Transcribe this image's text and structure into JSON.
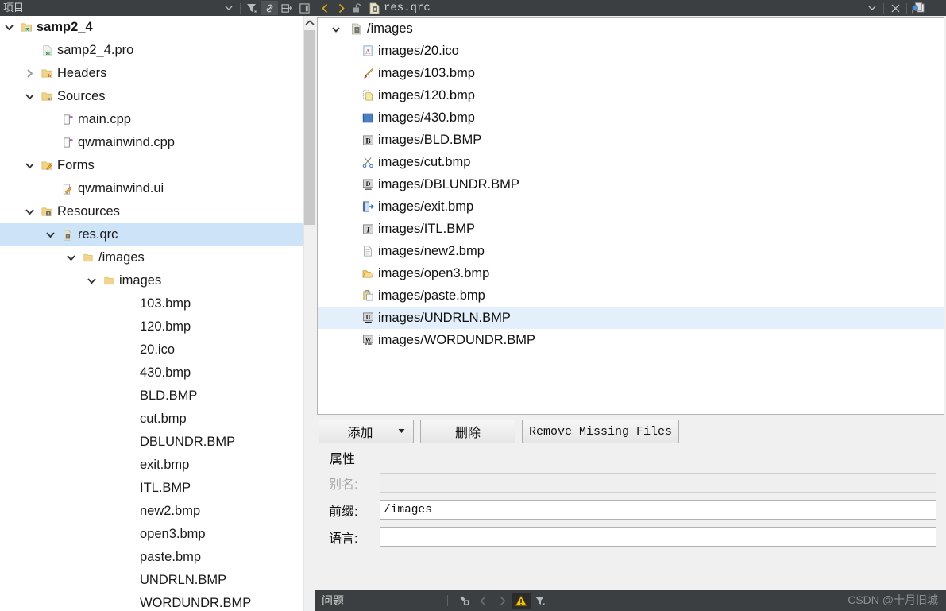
{
  "left_panel": {
    "title": "项目",
    "toolbar": [
      {
        "name": "dropdown-arrow-icon",
        "glyph": "▾"
      },
      {
        "name": "filter-icon",
        "glyph": "filter"
      },
      {
        "name": "link-icon",
        "glyph": "link"
      },
      {
        "name": "split-add-icon",
        "glyph": "split"
      },
      {
        "name": "collapse-panel-icon",
        "glyph": "panel"
      }
    ],
    "tree": [
      {
        "label": "samp2_4",
        "indent": 0,
        "twisty": "expanded",
        "icon": "qt-project-folder-icon",
        "bold": true,
        "selected": false
      },
      {
        "label": "samp2_4.pro",
        "indent": 1,
        "twisty": "none",
        "icon": "qt-pro-file-icon",
        "bold": false,
        "selected": false
      },
      {
        "label": "Headers",
        "indent": 1,
        "twisty": "collapsed",
        "icon": "headers-folder-icon",
        "bold": false,
        "selected": false
      },
      {
        "label": "Sources",
        "indent": 1,
        "twisty": "expanded",
        "icon": "sources-folder-icon",
        "bold": false,
        "selected": false
      },
      {
        "label": "main.cpp",
        "indent": 2,
        "twisty": "none",
        "icon": "cpp-file-icon",
        "bold": false,
        "selected": false
      },
      {
        "label": "qwmainwind.cpp",
        "indent": 2,
        "twisty": "none",
        "icon": "cpp-file-icon",
        "bold": false,
        "selected": false
      },
      {
        "label": "Forms",
        "indent": 1,
        "twisty": "expanded",
        "icon": "forms-folder-icon",
        "bold": false,
        "selected": false
      },
      {
        "label": "qwmainwind.ui",
        "indent": 2,
        "twisty": "none",
        "icon": "ui-file-icon",
        "bold": false,
        "selected": false
      },
      {
        "label": "Resources",
        "indent": 1,
        "twisty": "expanded",
        "icon": "resources-folder-icon",
        "bold": false,
        "selected": false
      },
      {
        "label": "res.qrc",
        "indent": 2,
        "twisty": "expanded",
        "icon": "qrc-file-icon",
        "bold": false,
        "selected": true
      },
      {
        "label": "/images",
        "indent": 3,
        "twisty": "expanded",
        "icon": "folder-icon",
        "bold": false,
        "selected": false
      },
      {
        "label": "images",
        "indent": 4,
        "twisty": "expanded",
        "icon": "folder-icon",
        "bold": false,
        "selected": false
      },
      {
        "label": "103.bmp",
        "indent": 5,
        "twisty": "none",
        "icon": "none",
        "bold": false,
        "selected": false
      },
      {
        "label": "120.bmp",
        "indent": 5,
        "twisty": "none",
        "icon": "none",
        "bold": false,
        "selected": false
      },
      {
        "label": "20.ico",
        "indent": 5,
        "twisty": "none",
        "icon": "none",
        "bold": false,
        "selected": false
      },
      {
        "label": "430.bmp",
        "indent": 5,
        "twisty": "none",
        "icon": "none",
        "bold": false,
        "selected": false
      },
      {
        "label": "BLD.BMP",
        "indent": 5,
        "twisty": "none",
        "icon": "none",
        "bold": false,
        "selected": false
      },
      {
        "label": "cut.bmp",
        "indent": 5,
        "twisty": "none",
        "icon": "none",
        "bold": false,
        "selected": false
      },
      {
        "label": "DBLUNDR.BMP",
        "indent": 5,
        "twisty": "none",
        "icon": "none",
        "bold": false,
        "selected": false
      },
      {
        "label": "exit.bmp",
        "indent": 5,
        "twisty": "none",
        "icon": "none",
        "bold": false,
        "selected": false
      },
      {
        "label": "ITL.BMP",
        "indent": 5,
        "twisty": "none",
        "icon": "none",
        "bold": false,
        "selected": false
      },
      {
        "label": "new2.bmp",
        "indent": 5,
        "twisty": "none",
        "icon": "none",
        "bold": false,
        "selected": false
      },
      {
        "label": "open3.bmp",
        "indent": 5,
        "twisty": "none",
        "icon": "none",
        "bold": false,
        "selected": false
      },
      {
        "label": "paste.bmp",
        "indent": 5,
        "twisty": "none",
        "icon": "none",
        "bold": false,
        "selected": false
      },
      {
        "label": "UNDRLN.BMP",
        "indent": 5,
        "twisty": "none",
        "icon": "none",
        "bold": false,
        "selected": false
      },
      {
        "label": "WORDUNDR.BMP",
        "indent": 5,
        "twisty": "none",
        "icon": "none",
        "bold": false,
        "selected": false
      }
    ]
  },
  "editor": {
    "tab_title": "res.qrc",
    "nav_back_icon": "chevron-left-icon",
    "nav_forward_icon": "chevron-right-icon",
    "lock_icon": "unlocked-icon",
    "file_icon": "qrc-file-icon",
    "dropdown_icon": "chevron-down-icon",
    "close_icon": "close-icon",
    "split_icon": "split-editor-icon"
  },
  "qrc_editor": {
    "prefix_header": {
      "label": "/images",
      "icon": "qrc-prefix-icon"
    },
    "files": [
      {
        "label": "images/20.ico",
        "icon": "ico-image-icon",
        "selected": false
      },
      {
        "label": "images/103.bmp",
        "icon": "pencil-icon",
        "selected": false
      },
      {
        "label": "images/120.bmp",
        "icon": "copy-icon",
        "selected": false
      },
      {
        "label": "images/430.bmp",
        "icon": "blue-square-icon",
        "selected": false
      },
      {
        "label": "images/BLD.BMP",
        "icon": "bold-icon",
        "selected": false
      },
      {
        "label": "images/cut.bmp",
        "icon": "scissors-icon",
        "selected": false
      },
      {
        "label": "images/DBLUNDR.BMP",
        "icon": "double-underline-icon",
        "selected": false
      },
      {
        "label": "images/exit.bmp",
        "icon": "exit-door-icon",
        "selected": false
      },
      {
        "label": "images/ITL.BMP",
        "icon": "italic-icon",
        "selected": false
      },
      {
        "label": "images/new2.bmp",
        "icon": "new-document-icon",
        "selected": false
      },
      {
        "label": "images/open3.bmp",
        "icon": "open-folder-icon",
        "selected": false
      },
      {
        "label": "images/paste.bmp",
        "icon": "paste-icon",
        "selected": false
      },
      {
        "label": "images/UNDRLN.BMP",
        "icon": "underline-icon",
        "selected": true
      },
      {
        "label": "images/WORDUNDR.BMP",
        "icon": "word-underline-icon",
        "selected": false
      }
    ],
    "buttons": {
      "add": "添加",
      "add_caret": "▼",
      "remove": "删除",
      "remove_missing": "Remove Missing Files"
    },
    "properties": {
      "legend": "属性",
      "alias": {
        "label": "别名:",
        "value": "",
        "disabled": true
      },
      "prefix": {
        "label": "前缀:",
        "value": "/images",
        "disabled": false
      },
      "language": {
        "label": "语言:",
        "value": "",
        "disabled": false
      }
    }
  },
  "problems_bar": {
    "title": "问题",
    "icons": [
      {
        "name": "clear-icon",
        "state": "normal"
      },
      {
        "name": "previous-issue-icon",
        "state": "dim"
      },
      {
        "name": "next-issue-icon",
        "state": "dim"
      },
      {
        "name": "warning-filter-icon",
        "state": "warn"
      },
      {
        "name": "filter-icon",
        "state": "normal"
      }
    ]
  },
  "watermark": "CSDN @十月旧城",
  "colors": {
    "dark_chrome": "#3c3f41",
    "tree_selection": "#cde3f8",
    "list_selection": "#e3effb",
    "panel_bg": "#f0f0f0",
    "warning_yellow": "#f0c419"
  }
}
